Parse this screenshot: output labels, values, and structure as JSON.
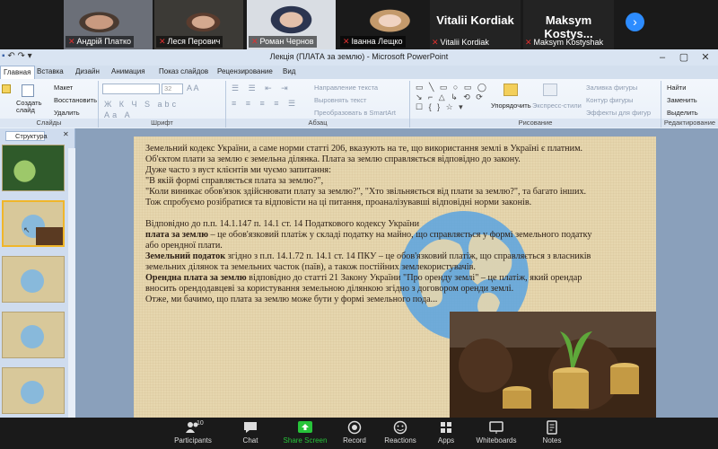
{
  "gallery": {
    "participants": [
      {
        "name": "Андрій Платко"
      },
      {
        "name": "Леся Перович"
      },
      {
        "name": "Роман Чернов"
      },
      {
        "name": "Іванна Лещко"
      },
      {
        "name": "Vitalii Kordiak",
        "display": "Vitalii Kordiak"
      },
      {
        "name": "Maksym Kostyshak",
        "display": "Maksym Kostys..."
      }
    ]
  },
  "ppt": {
    "title": "Лекція  (ПЛАТА за землю) - Microsoft PowerPoint",
    "tabs": [
      "Главная",
      "Вставка",
      "Дизайн",
      "Анимация",
      "Показ слайдов",
      "Рецензирование",
      "Вид"
    ],
    "ribbon": {
      "clipboard": {
        "label": "Слайды",
        "new_slide": "Создать слайд",
        "layout": "Макет",
        "reset": "Восстановить",
        "delete": "Удалить"
      },
      "font": {
        "label": "Шрифт",
        "size": "32"
      },
      "paragraph": {
        "label": "Абзац",
        "text_direction": "Направление текста",
        "align_text": "Выровнять текст",
        "smartart": "Преобразовать в SmartArt"
      },
      "drawing": {
        "label": "Рисование",
        "arrange": "Упорядочить",
        "quick_styles": "Экспресс-стили",
        "fill": "Заливка фигуры",
        "outline": "Контур фигуры",
        "effects": "Эффекты для фигур"
      },
      "editing": {
        "label": "Редактирование",
        "find": "Найти",
        "replace": "Заменить",
        "select": "Выделить"
      }
    },
    "left_panel": {
      "tab_label": "Структура"
    },
    "slide": {
      "lines": [
        "Земельний кодекс України, а саме норми статті 206, вказують на те, що використання землі в Україні є платним.",
        "Об'єктом плати за землю є земельна ділянка. Плата за землю справляється відповідно до закону.",
        "Дуже часто з вуст клієнтів ми чуємо запитання:",
        "\"В якій формі справляється плата за землю?\",",
        "\"Коли виникає обов'язок здійснювати плату за землю?\", \"Хто звільняється від плати за землю?\", та багато інших.",
        "Тож спробуємо розібратися та відповісти на ці питання, проаналізувавші відповідні норми законів.",
        "Відповідно до п.п. 14.1.147 п. 14.1 ст. 14 Податкового кодексу України",
        "– це обов'язковий платіж у складі податку на майно, що справляється у формі земельного податку",
        "або орендної плати.",
        "згідно з п.п. 14.1.72 п. 14.1 ст. 14 ПКУ – це обов'язковий платіж, що справляється з власників",
        "земельних ділянок та земельних часток (паїв), а також постійних землекористувачів.",
        "відповідно до статті 21 Закону України \"Про оренду землі\" – це платіж, який орендар",
        "вносить орендодавцеві за користування земельною ділянкою згідно з договором оренди землі.",
        "Отже, ми бачимо, що плата за землю може бути у формі земельного пода..."
      ],
      "bold_terms": [
        "плата за землю",
        "Земельний податок",
        "Орендна плата за землю",
        "платним."
      ]
    }
  },
  "zoom_toolbar": {
    "participants_label": "Participants",
    "participants_count": "10",
    "chat_label": "Chat",
    "share_label": "Share Screen",
    "record_label": "Record",
    "reactions_label": "Reactions",
    "apps_label": "Apps",
    "whiteboards_label": "Whiteboards",
    "notes_label": "Notes"
  },
  "colors": {
    "zoom_accent": "#2d8cff",
    "share_green": "#27c43a",
    "mic_off_red": "#e0302f"
  }
}
